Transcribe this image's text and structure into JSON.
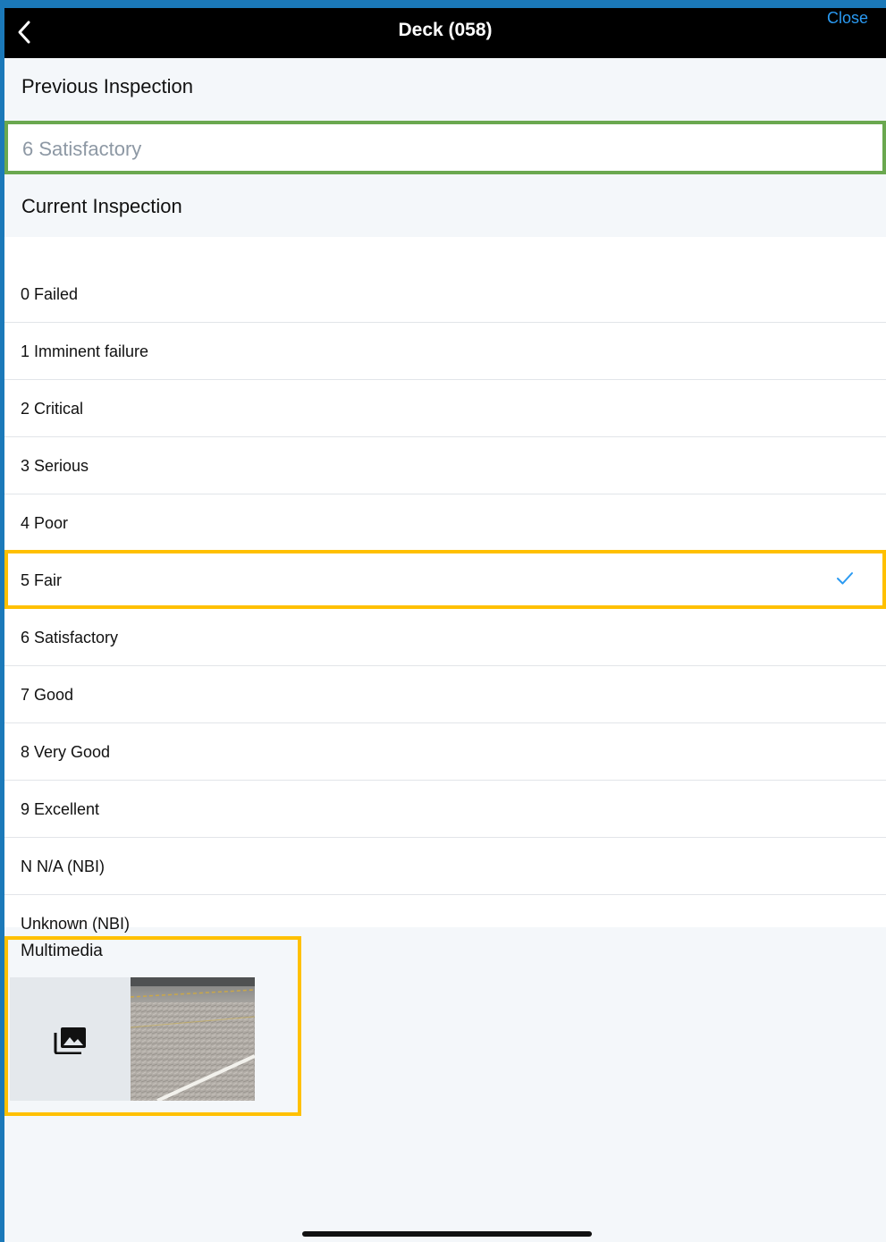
{
  "navbar": {
    "title": "Deck (058)",
    "close_label": "Close",
    "back_icon": "chevron-left-icon"
  },
  "previous": {
    "header": "Previous Inspection",
    "value": "6 Satisfactory"
  },
  "current": {
    "header": "Current Inspection",
    "options": [
      {
        "label": "0 Failed"
      },
      {
        "label": "1 Imminent failure"
      },
      {
        "label": "2 Critical"
      },
      {
        "label": "3 Serious"
      },
      {
        "label": "4 Poor"
      },
      {
        "label": "5 Fair",
        "selected": true
      },
      {
        "label": "6 Satisfactory"
      },
      {
        "label": "7 Good"
      },
      {
        "label": "8 Very Good"
      },
      {
        "label": "9 Excellent"
      },
      {
        "label": "N N/A (NBI)"
      },
      {
        "label": "Unknown (NBI)"
      }
    ]
  },
  "multimedia": {
    "header": "Multimedia",
    "add_icon": "photo-library-icon",
    "thumbnail_icon": "bridge-deck-photo"
  },
  "colors": {
    "accent": "#2a9af2",
    "previous_outline": "#6aa84f",
    "highlight_outline": "#ffc000",
    "navbar": "#000000",
    "frame": "#1b79b9"
  }
}
